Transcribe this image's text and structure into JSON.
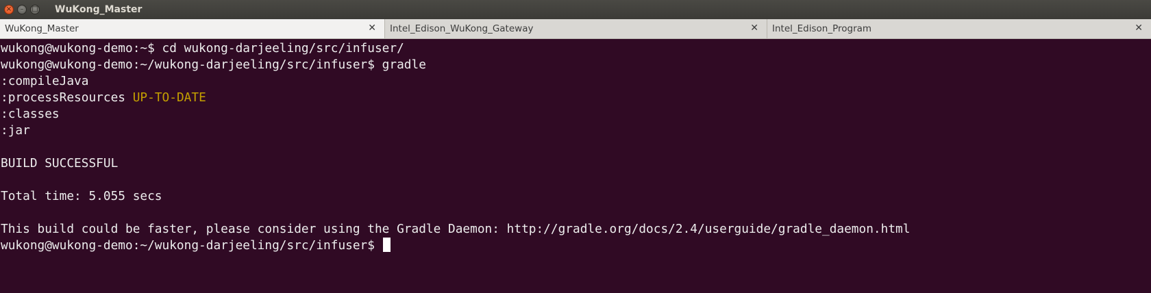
{
  "window": {
    "title": "WuKong_Master"
  },
  "tabs": [
    {
      "label": "WuKong_Master",
      "active": true
    },
    {
      "label": "Intel_Edison_WuKong_Gateway",
      "active": false
    },
    {
      "label": "Intel_Edison_Program",
      "active": false
    }
  ],
  "terminal": {
    "lines": [
      "wukong@wukong-demo:~$ cd wukong-darjeeling/src/infuser/",
      "wukong@wukong-demo:~/wukong-darjeeling/src/infuser$ gradle",
      ":compileJava",
      ":processResources",
      ":classes",
      ":jar",
      "",
      "BUILD SUCCESSFUL",
      "",
      "Total time: 5.055 secs",
      "",
      "This build could be faster, please consider using the Gradle Daemon: http://gradle.org/docs/2.4/userguide/gradle_daemon.html",
      "wukong@wukong-demo:~/wukong-darjeeling/src/infuser$ "
    ],
    "up_to_date": "UP-TO-DATE",
    "highlight_color": "#c4a000",
    "background_color": "#300a24"
  },
  "icons": {
    "close": "×",
    "minimize": "–",
    "maximize": "□",
    "tab_close": "✕"
  }
}
